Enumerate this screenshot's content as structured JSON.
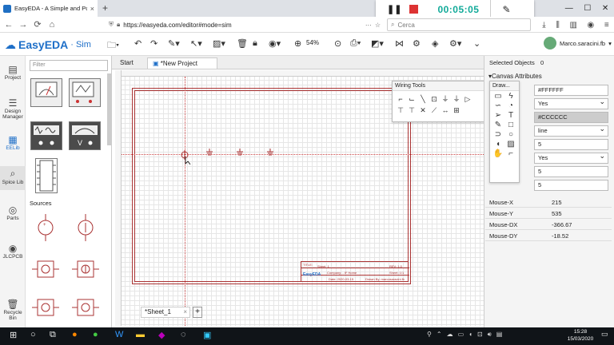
{
  "browser": {
    "tab_title": "EasyEDA - A Simple and Powe",
    "tab_close": "×",
    "new_tab": "+",
    "url": "https://easyeda.com/editor#mode=sim",
    "search_placeholder": "Cerca"
  },
  "recorder": {
    "time": "00:05:05"
  },
  "app": {
    "logo_name": "EasyEDA",
    "logo_sep": "·",
    "logo_mode": "Sim",
    "zoom": "54%",
    "user": "Marco.saracini.fb"
  },
  "rail": {
    "items": [
      {
        "label": "Project",
        "icon": "folder-icon"
      },
      {
        "label": "Design Manager",
        "icon": "tree-icon"
      },
      {
        "label": "EELib",
        "icon": "library-icon"
      },
      {
        "label": "Spice Lib",
        "icon": "search-icon"
      },
      {
        "label": "Parts",
        "icon": "parts-icon"
      },
      {
        "label": "JLCPCB",
        "icon": "jlcpcb-icon"
      },
      {
        "label": "Recycle Bin",
        "icon": "trash-icon"
      }
    ]
  },
  "library": {
    "filter_placeholder": "Filter",
    "section_sources": "Sources"
  },
  "canvas": {
    "tabs": {
      "start": "Start",
      "project": "*New Project"
    },
    "sheet": "*Sheet_1",
    "add_sheet": "+",
    "title_block": {
      "title_label": "TITLE:",
      "title_value": "Sheet_1",
      "rev": "REV: 1.0",
      "company": "Company: - IF Home",
      "sheet": "Sheet: 1/1",
      "date": "Date: 2020-03-15",
      "drawn": "Drawn By: marcosaracini.fb",
      "logo": "EasyEDA"
    }
  },
  "wiring_tools": {
    "title": "Wiring Tools"
  },
  "drawing_tools": {
    "title": "Draw..."
  },
  "properties": {
    "selected_label": "Selected Objects",
    "selected_count": "0",
    "canvas_attributes": "Canvas Attributes",
    "fields": [
      "#FFFFFF",
      "Yes",
      "#CCCCCC",
      "line",
      "5",
      "Yes",
      "5",
      "5"
    ],
    "mouse": [
      {
        "label": "Mouse-X",
        "value": "215"
      },
      {
        "label": "Mouse-Y",
        "value": "535"
      },
      {
        "label": "Mouse-DX",
        "value": "-366.67"
      },
      {
        "label": "Mouse-DY",
        "value": "-18.52"
      }
    ]
  },
  "taskbar": {
    "time": "15:28",
    "date": "15/03/2020"
  }
}
